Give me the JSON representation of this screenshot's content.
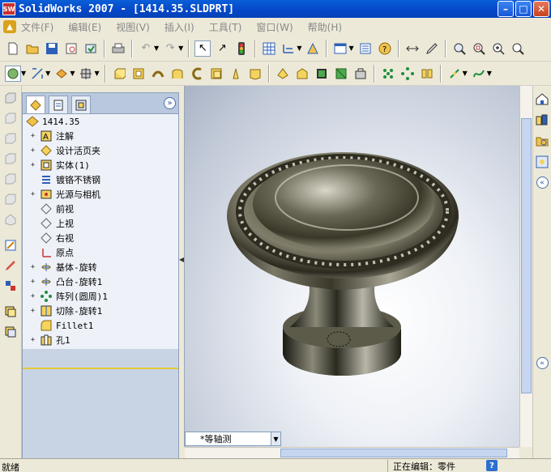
{
  "window": {
    "title": "SolidWorks 2007 - [1414.35.SLDPRT]",
    "app_icon": "SW",
    "controls": [
      "minimize-icon",
      "maximize-icon",
      "close-icon"
    ]
  },
  "menu": {
    "logo_icon": "solidworks-logo-icon",
    "items": [
      "文件(F)",
      "编辑(E)",
      "视图(V)",
      "插入(I)",
      "工具(T)",
      "窗口(W)",
      "帮助(H)"
    ]
  },
  "toolbar1": [
    "new-icon",
    "open-icon",
    "save-icon",
    "print-preview-icon",
    "rebuild-icon",
    "print-icon",
    "undo-icon",
    "redo-icon",
    "select-icon",
    "select-other-icon",
    "traffic-light-icon",
    "grid-icon",
    "dimension-icon",
    "options-icon",
    "view-orientation-icon",
    "display-icon",
    "help-icon",
    "rollback-icon",
    "edit-icon",
    "zoom-to-fit-icon",
    "zoom-area-icon",
    "zoom-in-icon",
    "zoom-icon"
  ],
  "toolbar2": [
    "sketch-icon",
    "smart-dimension-icon",
    "relation-icon",
    "reference-icon",
    "extrude-boss-icon",
    "revolve-boss-icon",
    "sweep-icon",
    "loft-icon",
    "extrude-cut-icon",
    "revolve-cut-icon",
    "fillet-icon",
    "chamfer-icon",
    "rib-icon",
    "shell-icon",
    "draft-icon",
    "hole-icon",
    "linear-pattern-icon",
    "circular-pattern-icon",
    "mirror-icon",
    "reference-point-icon",
    "curve-icon"
  ],
  "feature_tree": {
    "tabs": [
      "featuremanager-tab-icon",
      "propertymanager-tab-icon",
      "configuration-tab-icon"
    ],
    "root": "1414.35",
    "items": [
      {
        "label": "注解",
        "expand": "+",
        "icon": "annotation-icon"
      },
      {
        "label": "设计活页夹",
        "expand": "+",
        "icon": "design-binder-icon"
      },
      {
        "label": "实体(1)",
        "expand": "+",
        "icon": "solid-body-icon"
      },
      {
        "label": "镀铬不锈钢",
        "expand": "",
        "icon": "material-icon"
      },
      {
        "label": "光源与相机",
        "expand": "+",
        "icon": "lights-icon"
      },
      {
        "label": "前视",
        "expand": "",
        "icon": "plane-icon"
      },
      {
        "label": "上视",
        "expand": "",
        "icon": "plane-icon"
      },
      {
        "label": "右视",
        "expand": "",
        "icon": "plane-icon"
      },
      {
        "label": "原点",
        "expand": "",
        "icon": "origin-icon"
      },
      {
        "label": "基体-旋转",
        "expand": "+",
        "icon": "revolve-icon"
      },
      {
        "label": "凸台-旋转1",
        "expand": "+",
        "icon": "revolve-icon"
      },
      {
        "label": "阵列(圆周)1",
        "expand": "+",
        "icon": "circular-pattern-icon"
      },
      {
        "label": "切除-旋转1",
        "expand": "+",
        "icon": "cut-revolve-icon"
      },
      {
        "label": "Fillet1",
        "expand": "",
        "icon": "fillet-icon"
      },
      {
        "label": "孔1",
        "expand": "+",
        "icon": "hole-icon"
      }
    ]
  },
  "viewport": {
    "view_orientation": "*等轴测",
    "model": "chrome-cabinet-knob"
  },
  "status": {
    "left": "就绪",
    "mode": "正在编辑：零件",
    "help": "?"
  },
  "colors": {
    "titlebar": "#0446c6",
    "tree_background": "#eef2f8",
    "panel": "#c8d4e4",
    "tree_end_line": "#e1c93a"
  }
}
